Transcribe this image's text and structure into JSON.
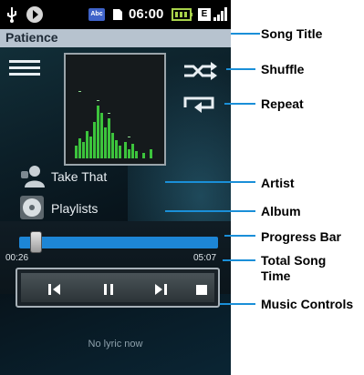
{
  "status_bar": {
    "time": "06:00",
    "keyboard_badge": "Abc",
    "network_badge": "E"
  },
  "song_title": "Patience",
  "artist": "Take That",
  "album": "Playlists",
  "progress": {
    "fraction": 0.06,
    "elapsed": "00:26",
    "total": "05:07"
  },
  "lyric_text": "No lyric now",
  "icons": [
    "usb-icon",
    "media-play-icon",
    "keyboard-icon",
    "sd-card-icon",
    "battery-icon",
    "network-icon",
    "signal-icon",
    "menu-icon",
    "shuffle-icon",
    "repeat-icon",
    "artist-icon",
    "album-icon",
    "previous-icon",
    "pause-icon",
    "next-icon",
    "stop-icon"
  ],
  "colors": {
    "progress": "#1d86d6",
    "title_bar": "#b7c3cf",
    "equalizer": "#3cc43c"
  },
  "callouts": [
    {
      "key": "song_title",
      "label": "Song Title"
    },
    {
      "key": "shuffle",
      "label": "Shuffle"
    },
    {
      "key": "repeat",
      "label": "Repeat"
    },
    {
      "key": "artist",
      "label": "Artist"
    },
    {
      "key": "album",
      "label": "Album"
    },
    {
      "key": "progress_bar",
      "label": "Progress Bar"
    },
    {
      "key": "total_time",
      "label": "Total Song Time"
    },
    {
      "key": "controls",
      "label": "Music Controls"
    }
  ]
}
